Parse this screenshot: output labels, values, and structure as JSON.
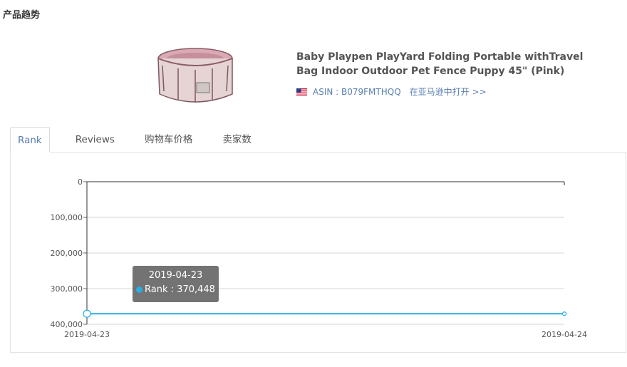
{
  "section_title": "产品趋势",
  "product": {
    "title": "Baby Playpen PlayYard Folding Portable withTravel Bag Indoor Outdoor Pet Fence Puppy 45\" (Pink)",
    "asin_label": "ASIN : B079FMTHQQ",
    "open_link": "在亚马逊中打开 >>",
    "flag_icon": "us-flag-icon",
    "thumbnail_icon": "playpen-product-image"
  },
  "tabs": [
    {
      "label": "Rank",
      "active": true
    },
    {
      "label": "Reviews",
      "active": false
    },
    {
      "label": "购物车价格",
      "active": false
    },
    {
      "label": "卖家数",
      "active": false
    }
  ],
  "colors": {
    "accent": "#5a7fb0",
    "series": "#28aee4"
  },
  "tooltip": {
    "date": "2019-04-23",
    "series_label": "Rank : 370,448"
  },
  "chart_data": {
    "type": "line",
    "x": [
      "2019-04-23",
      "2019-04-24"
    ],
    "series": [
      {
        "name": "Rank",
        "values": [
          370448,
          370448
        ]
      }
    ],
    "y_ticks": [
      "0",
      "100,000",
      "200,000",
      "300,000",
      "400,000"
    ],
    "y_tick_values": [
      0,
      100000,
      200000,
      300000,
      400000
    ],
    "ylim": [
      0,
      400000
    ],
    "y_inverted": true,
    "grid": true
  }
}
